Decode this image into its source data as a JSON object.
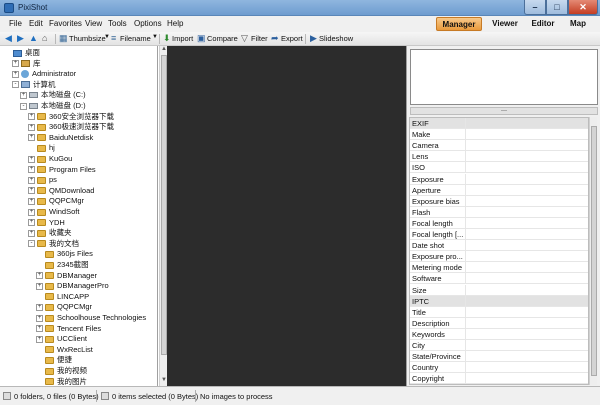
{
  "window": {
    "title": "PixiShot"
  },
  "menu": [
    "File",
    "Edit",
    "Favorites",
    "View",
    "Tools",
    "Options",
    "Help"
  ],
  "modes": [
    {
      "label": "Manager",
      "active": true
    },
    {
      "label": "Viewer",
      "active": false
    },
    {
      "label": "Editor",
      "active": false
    },
    {
      "label": "Map",
      "active": false
    }
  ],
  "toolbar": {
    "thumbsize": "Thumbsize",
    "filename": "Filename",
    "import": "Import",
    "compare": "Compare",
    "filter": "Filter",
    "export": "Export",
    "slideshow": "Slideshow"
  },
  "tree": [
    {
      "label": "桌面",
      "depth": 0,
      "icon": "desk",
      "exp": ""
    },
    {
      "label": "库",
      "depth": 1,
      "icon": "lib",
      "exp": "+"
    },
    {
      "label": "Administrator",
      "depth": 1,
      "icon": "user",
      "exp": "+"
    },
    {
      "label": "计算机",
      "depth": 1,
      "icon": "pc",
      "exp": "-"
    },
    {
      "label": "本地磁盘 (C:)",
      "depth": 2,
      "icon": "drive",
      "exp": "+"
    },
    {
      "label": "本地磁盘 (D:)",
      "depth": 2,
      "icon": "drive",
      "exp": "-"
    },
    {
      "label": "360安全浏览器下载",
      "depth": 3,
      "icon": "folder",
      "exp": "+"
    },
    {
      "label": "360极速浏览器下载",
      "depth": 3,
      "icon": "folder",
      "exp": "+"
    },
    {
      "label": "BaiduNetdisk",
      "depth": 3,
      "icon": "folder",
      "exp": "+"
    },
    {
      "label": "hj",
      "depth": 3,
      "icon": "folder",
      "exp": ""
    },
    {
      "label": "KuGou",
      "depth": 3,
      "icon": "folder",
      "exp": "+"
    },
    {
      "label": "Program Files",
      "depth": 3,
      "icon": "folder",
      "exp": "+"
    },
    {
      "label": "ps",
      "depth": 3,
      "icon": "folder",
      "exp": "+"
    },
    {
      "label": "QMDownload",
      "depth": 3,
      "icon": "folder",
      "exp": "+"
    },
    {
      "label": "QQPCMgr",
      "depth": 3,
      "icon": "folder",
      "exp": "+"
    },
    {
      "label": "WindSoft",
      "depth": 3,
      "icon": "folder",
      "exp": "+"
    },
    {
      "label": "YDH",
      "depth": 3,
      "icon": "folder",
      "exp": "+"
    },
    {
      "label": "收藏夹",
      "depth": 3,
      "icon": "folder",
      "exp": "+"
    },
    {
      "label": "我的文档",
      "depth": 3,
      "icon": "folder",
      "exp": "-"
    },
    {
      "label": "360js Files",
      "depth": 4,
      "icon": "folder",
      "exp": ""
    },
    {
      "label": "2345截图",
      "depth": 4,
      "icon": "folder",
      "exp": ""
    },
    {
      "label": "DBManager",
      "depth": 4,
      "icon": "folder",
      "exp": "+"
    },
    {
      "label": "DBManagerPro",
      "depth": 4,
      "icon": "folder",
      "exp": "+"
    },
    {
      "label": "LINCAPP",
      "depth": 4,
      "icon": "folder",
      "exp": ""
    },
    {
      "label": "QQPCMgr",
      "depth": 4,
      "icon": "folder",
      "exp": "+"
    },
    {
      "label": "Schoolhouse Technologies",
      "depth": 4,
      "icon": "folder",
      "exp": "+"
    },
    {
      "label": "Tencent Files",
      "depth": 4,
      "icon": "folder",
      "exp": "+"
    },
    {
      "label": "UCClient",
      "depth": 4,
      "icon": "folder",
      "exp": "+"
    },
    {
      "label": "WxRecList",
      "depth": 4,
      "icon": "folder",
      "exp": ""
    },
    {
      "label": "便捷",
      "depth": 4,
      "icon": "folder",
      "exp": ""
    },
    {
      "label": "我的视频",
      "depth": 4,
      "icon": "folder",
      "exp": ""
    },
    {
      "label": "我的图片",
      "depth": 4,
      "icon": "folder",
      "exp": ""
    }
  ],
  "properties": [
    {
      "label": "EXIF",
      "group": true
    },
    {
      "label": "Make",
      "group": false
    },
    {
      "label": "Camera",
      "group": false
    },
    {
      "label": "Lens",
      "group": false
    },
    {
      "label": "ISO",
      "group": false
    },
    {
      "label": "Exposure",
      "group": false
    },
    {
      "label": "Aperture",
      "group": false
    },
    {
      "label": "Exposure bias",
      "group": false
    },
    {
      "label": "Flash",
      "group": false
    },
    {
      "label": "Focal length",
      "group": false
    },
    {
      "label": "Focal length [...",
      "group": false
    },
    {
      "label": "Date shot",
      "group": false
    },
    {
      "label": "Exposure pro...",
      "group": false
    },
    {
      "label": "Metering mode",
      "group": false
    },
    {
      "label": "Software",
      "group": false
    },
    {
      "label": "Size",
      "group": false
    },
    {
      "label": "IPTC",
      "group": true
    },
    {
      "label": "Title",
      "group": false
    },
    {
      "label": "Description",
      "group": false
    },
    {
      "label": "Keywords",
      "group": false
    },
    {
      "label": "City",
      "group": false
    },
    {
      "label": "State/Province",
      "group": false
    },
    {
      "label": "Country",
      "group": false
    },
    {
      "label": "Copyright",
      "group": false
    }
  ],
  "status": {
    "folders": "0 folders, 0 files (0 Bytes)",
    "selected": "0 items selected (0 Bytes)",
    "process": "No images to process"
  }
}
